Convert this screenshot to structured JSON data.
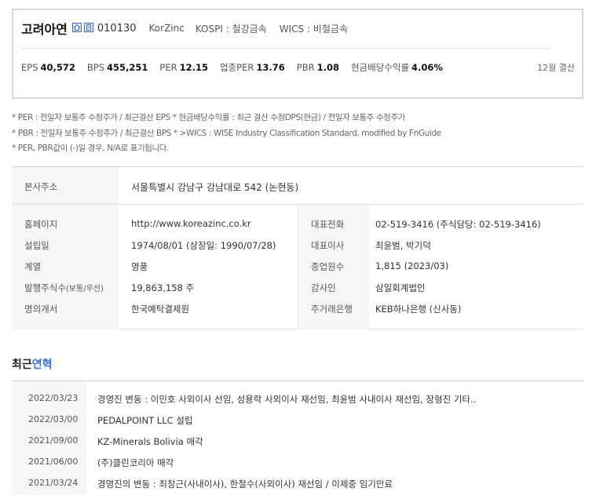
{
  "company": {
    "name": "고려아연",
    "code": "010130",
    "eng_name": "KorZinc",
    "market": "KOSPI : 철강금속",
    "wics": "WICS : 비철금속"
  },
  "metrics": [
    {
      "label": "EPS",
      "value": "40,572"
    },
    {
      "label": "BPS",
      "value": "455,251"
    },
    {
      "label": "PER",
      "value": "12.15"
    },
    {
      "label": "업종PER",
      "value": "13.76"
    },
    {
      "label": "PBR",
      "value": "1.08"
    },
    {
      "label": "현금배당수익률",
      "value": "4.06%"
    }
  ],
  "settlement": "12월 결산",
  "notes": [
    "* PER : 전일자 보통주 수정주가 / 최근결산 EPS * 현금배당수익률 : 최근 결산 수정DPS(현금) / 전일자 보통주 수정주가",
    "* PBR : 전일자 보통주 수정주가 / 최근결산 BPS * >WICS : WISE Industry Classification Standard, modified by FnGuide",
    "* PER, PBR값이 (-)일 경우, N/A로 표기됩니다."
  ],
  "address": {
    "label": "본사주소",
    "value": "서울특별시 강남구 강남대로 542 (논현동)"
  },
  "info_left": [
    {
      "label": "홈페이지",
      "value": "http://www.koreazinc.co.kr"
    },
    {
      "label": "설립일",
      "value": "1974/08/01 (상장일: 1990/07/28)"
    },
    {
      "label": "계열",
      "value": "영풍"
    },
    {
      "label": "발행주식수",
      "label_small": "(보통/우선)",
      "value": "19,863,158 주"
    },
    {
      "label": "명의개서",
      "value": "한국예탁결제원"
    }
  ],
  "info_right": [
    {
      "label": "대표전화",
      "value": "02-519-3416 (주식담당: 02-519-3416)"
    },
    {
      "label": "대표이사",
      "value": "최윤범, 박기덕"
    },
    {
      "label": "종업원수",
      "value": "1,815 (2023/03)"
    },
    {
      "label": "감사인",
      "value": "삼일회계법인"
    },
    {
      "label": "주거래은행",
      "value": "KEB하나은행 (신사동)"
    }
  ],
  "history_title": {
    "prefix": "최근",
    "highlight": "연혁"
  },
  "history": [
    {
      "date": "2022/03/23",
      "text": "경영진 변동 : 이민호 사외이사 선임, 성용락 사외이사 재선임, 최윤범 사내이사 재선임, 장형진 기타.."
    },
    {
      "date": "2022/03/00",
      "text": "PEDALPOINT LLC 설립"
    },
    {
      "date": "2021/09/00",
      "text": "KZ-Minerals Bolivia 매각"
    },
    {
      "date": "2021/06/00",
      "text": "(주)클린코리아 매각"
    },
    {
      "date": "2021/03/24",
      "text": "경영진의 변동 : 최창근(사내이사), 한철수(사외이사) 재선임 / 이제중 임기만료"
    }
  ],
  "colors": {
    "accent": "#2f6fd6",
    "border": "#d9d9d9",
    "shade": "#f6f6f6"
  }
}
